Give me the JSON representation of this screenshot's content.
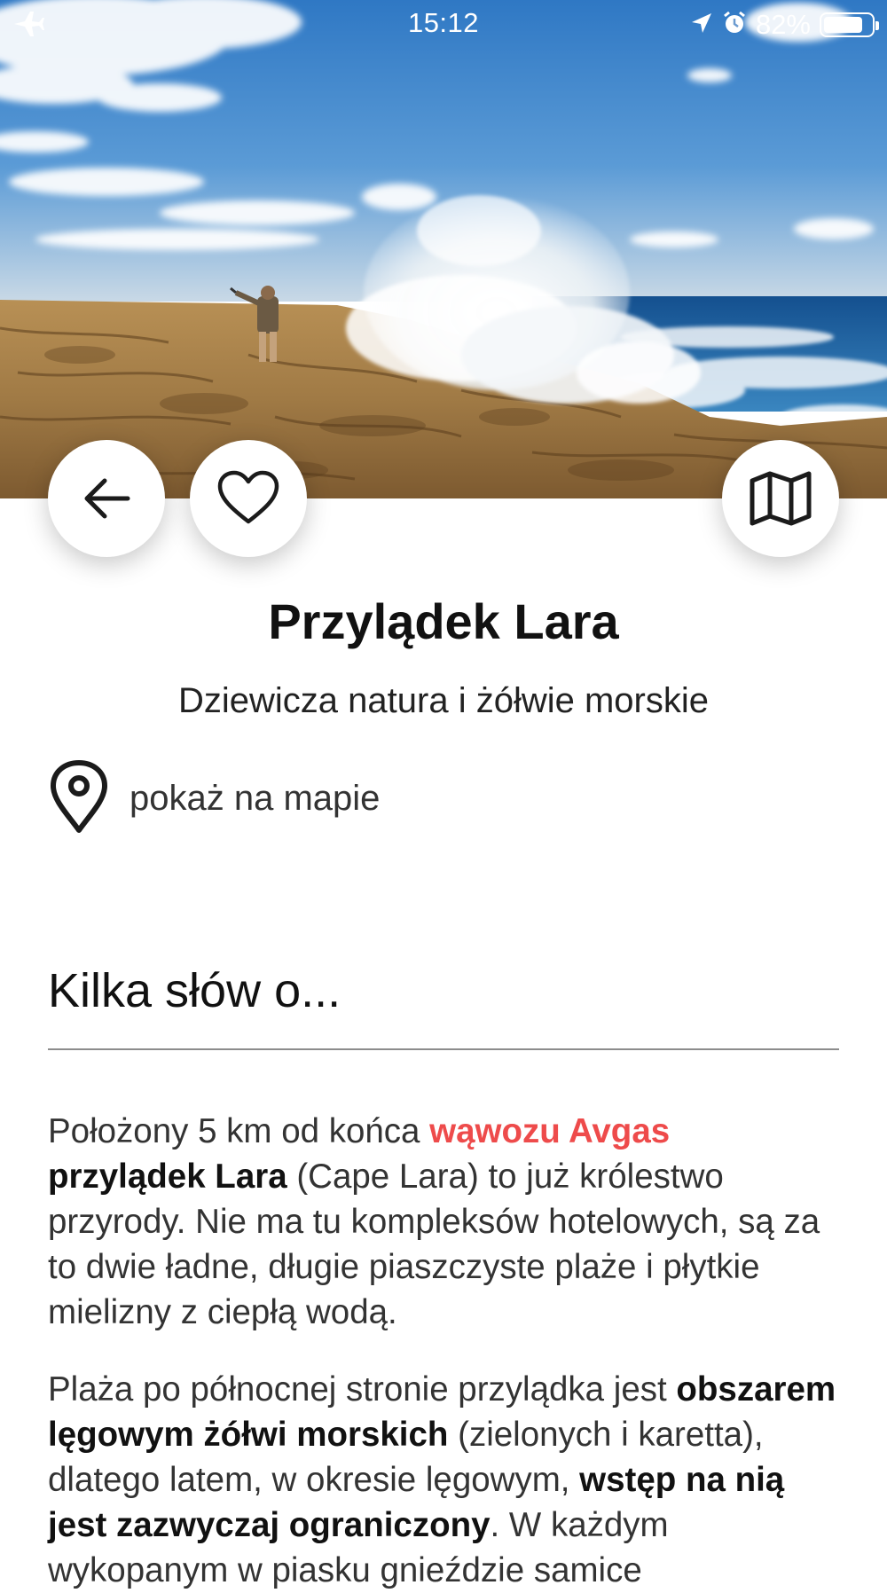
{
  "status_bar": {
    "time": "15:12",
    "battery_text": "82%",
    "battery_level_percent": 82,
    "left_icon": "airplane-icon",
    "right_icons": [
      "location-arrow-icon",
      "alarm-icon",
      "battery-icon"
    ]
  },
  "actions": {
    "back_icon": "arrow-left-icon",
    "favorite_icon": "heart-outline-icon",
    "map_icon": "folded-map-icon"
  },
  "place": {
    "title": "Przylądek Lara",
    "subtitle": "Dziewicza natura i żółwie morskie",
    "show_on_map_label": "pokaż na mapie",
    "show_on_map_icon": "map-pin-icon"
  },
  "section": {
    "heading": "Kilka słów o..."
  },
  "paragraphs": {
    "p1": {
      "t1": "Położony 5 km od końca ",
      "link": "wąwozu Avgas",
      "b1": "przylądek Lara",
      "t2": " (Cape Lara) to już królestwo przyrody. Nie ma tu kompleksów hotelowych, są za to dwie ładne, długie piaszczyste plaże i płytkie mielizny z ciepłą wodą."
    },
    "p2": {
      "t1": "Plaża po północnej stronie przylądka jest ",
      "b1": "obszarem lęgowym żółwi morskich",
      "t2": " (zielonych i karetta), dlatego latem, w okresie lęgowym, ",
      "b2": "wstęp na nią jest zazwyczaj ograniczony",
      "t3": ". W każdym wykopanym w piasku gnieździe samice"
    }
  },
  "colors": {
    "link": "#ee4b4b",
    "text": "#333333",
    "heading": "#111111",
    "divider": "#8c8c8c",
    "background": "#ffffff"
  }
}
